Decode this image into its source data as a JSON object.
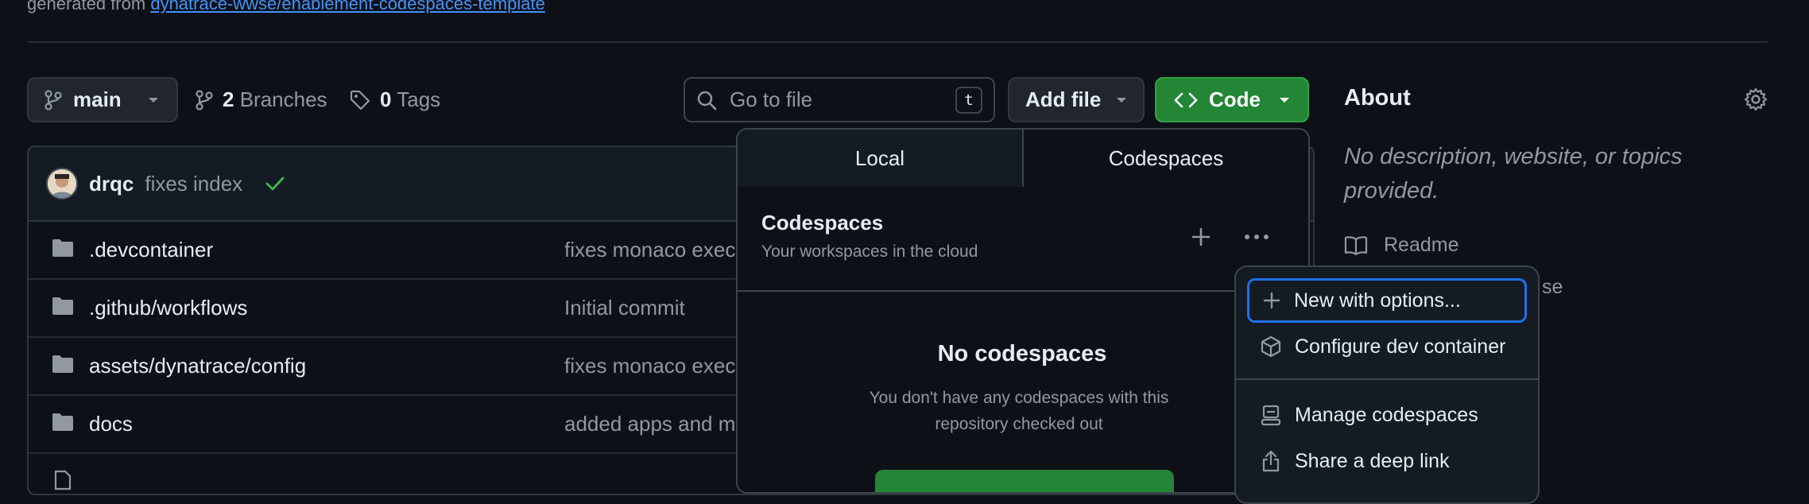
{
  "header": {
    "generated_prefix": "generated from",
    "template_link": "dynatrace-wwse/enablement-codespaces-template"
  },
  "toolbar": {
    "branch": "main",
    "branches_count": "2",
    "branches_label": "Branches",
    "tags_count": "0",
    "tags_label": "Tags",
    "search_placeholder": "Go to file",
    "search_shortcut": "t",
    "add_file_label": "Add file",
    "code_label": "Code"
  },
  "commit": {
    "user": "drqc",
    "message": "fixes index"
  },
  "files": [
    {
      "name": ".devcontainer",
      "message": "fixes monaco exec"
    },
    {
      "name": ".github/workflows",
      "message": "Initial commit"
    },
    {
      "name": "assets/dynatrace/config",
      "message": "fixes monaco exec"
    },
    {
      "name": "docs",
      "message": "added apps and m"
    }
  ],
  "about": {
    "title": "About",
    "description": "No description, website, or topics provided.",
    "readme": "Readme",
    "license_fragment": "se"
  },
  "code_panel": {
    "tab_local": "Local",
    "tab_codespaces": "Codespaces",
    "codespaces_title": "Codespaces",
    "codespaces_subtitle": "Your workspaces in the cloud",
    "empty_title": "No codespaces",
    "empty_subtitle": "You don't have any codespaces with this repository checked out"
  },
  "menu": {
    "items": [
      {
        "label": "New with options..."
      },
      {
        "label": "Configure dev container"
      },
      {
        "label": "Manage codespaces"
      },
      {
        "label": "Share a deep link"
      }
    ]
  },
  "colors": {
    "background": "#0d1117",
    "accent_green": "#238636",
    "link_blue": "#4493f8",
    "focus_blue": "#1f6feb"
  }
}
